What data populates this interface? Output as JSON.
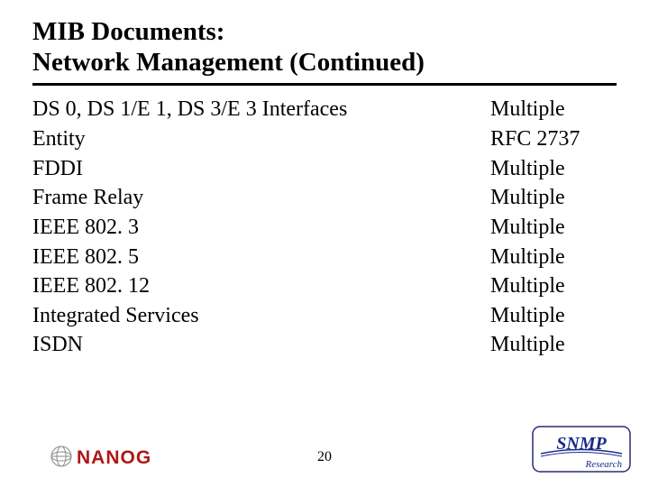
{
  "title_line1": "MIB Documents:",
  "title_line2": "Network Management (Continued)",
  "rows": [
    {
      "l": "DS 0, DS 1/E 1, DS 3/E 3 Interfaces",
      "r": "Multiple"
    },
    {
      "l": "Entity",
      "r": "RFC 2737"
    },
    {
      "l": "FDDI",
      "r": "Multiple"
    },
    {
      "l": "Frame Relay",
      "r": "Multiple"
    },
    {
      "l": "IEEE 802. 3",
      "r": "Multiple"
    },
    {
      "l": "IEEE 802. 5",
      "r": "Multiple"
    },
    {
      "l": "IEEE 802. 12",
      "r": "Multiple"
    },
    {
      "l": "Integrated Services",
      "r": "Multiple"
    },
    {
      "l": "ISDN",
      "r": "Multiple"
    }
  ],
  "page_number": "20",
  "logos": {
    "left_name": "NANOG",
    "right_name": "SNMP",
    "right_sub": "Research"
  }
}
